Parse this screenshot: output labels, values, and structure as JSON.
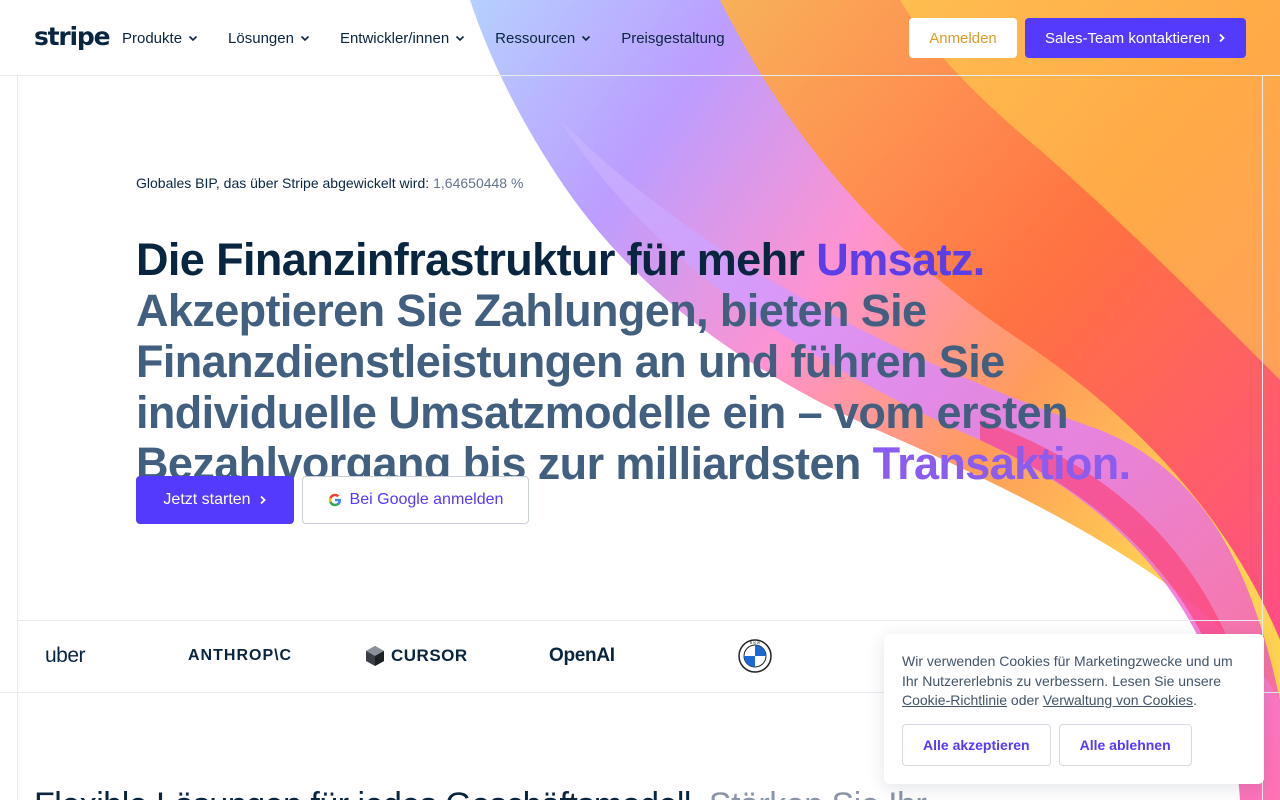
{
  "header": {
    "logo": "stripe",
    "nav": [
      {
        "label": "Produkte",
        "has_menu": true
      },
      {
        "label": "Lösungen",
        "has_menu": true
      },
      {
        "label": "Entwickler/innen",
        "has_menu": true
      },
      {
        "label": "Ressourcen",
        "has_menu": true
      },
      {
        "label": "Preisgestaltung",
        "has_menu": false
      }
    ],
    "signin_label": "Anmelden",
    "sales_label": "Sales-Team kontaktieren"
  },
  "hero": {
    "gdp_label": "Globales BIP, das über Stripe abgewickelt wird:",
    "gdp_value": "1,64650448 %",
    "headline_part1": "Die Finanzinfrastruktur für mehr ",
    "headline_part2": "Umsatz.",
    "headline_part3": " Akzeptieren Sie Zahlungen, bieten Sie Finanzdienstleistungen an und führen Sie individuelle Umsatzmodelle ein – vom ersten Bezahlvorgang bis zur milliardsten ",
    "headline_part4": "Transaktion.",
    "start_label": "Jetzt starten",
    "google_label": "Bei Google anmelden"
  },
  "logos": [
    "uber",
    "ANTHROP\\C",
    "CURSOR",
    "OpenAI",
    "BMW"
  ],
  "bottom": {
    "headline_dark": "Flexible Lösungen für jedes Geschäftsmodell.",
    "headline_soft": "Stärken Sie Ihr"
  },
  "cookie": {
    "text_main": "Wir verwenden Cookies für Marketingzwecke und um Ihr Nutzererlebnis zu verbessern. Lesen Sie unsere ",
    "link1": "Cookie-Richtlinie",
    "text_or": " oder ",
    "link2": "Verwaltung von Cookies",
    "text_end": ".",
    "accept_label": "Alle akzeptieren",
    "reject_label": "Alle ablehnen"
  },
  "colors": {
    "brand": "#533afd",
    "navy": "#0a2540",
    "signin": "#e19a26"
  }
}
